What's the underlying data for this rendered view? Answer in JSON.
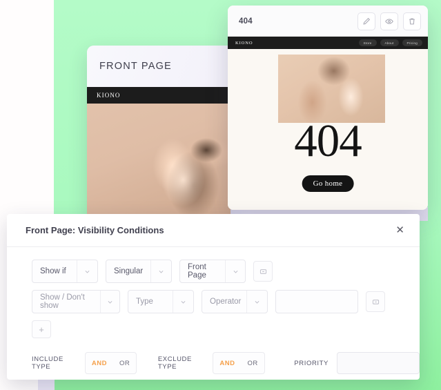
{
  "background": {
    "green": "#b3fbc7",
    "lavender": "#e6e2f4",
    "white": "#fffdfd"
  },
  "front_page_card": {
    "title": "FRONT PAGE",
    "brand": "KIONO"
  },
  "error_card": {
    "label": "404",
    "brand": "KIONO",
    "nav_items": [
      "Store",
      "About",
      "Pricing"
    ],
    "headline": "404",
    "button_label": "Go home",
    "actions": [
      {
        "name": "edit-icon",
        "title": "Edit"
      },
      {
        "name": "eye-icon",
        "title": "Preview"
      },
      {
        "name": "trash-icon",
        "title": "Delete"
      }
    ]
  },
  "modal": {
    "title": "Front Page: Visibility Conditions",
    "close_label": "✕",
    "rows": [
      {
        "selects": [
          {
            "value": "Show if",
            "placeholder": false
          },
          {
            "value": "Singular",
            "placeholder": false
          },
          {
            "value": "Front Page",
            "placeholder": false
          }
        ],
        "has_text_input": false,
        "text_input_value": "",
        "remove_label": "remove-condition"
      },
      {
        "selects": [
          {
            "value": "Show / Don't show",
            "placeholder": true
          },
          {
            "value": "Type",
            "placeholder": true
          },
          {
            "value": "Operator",
            "placeholder": true
          }
        ],
        "has_text_input": true,
        "text_input_value": "",
        "remove_label": "remove-condition"
      }
    ],
    "add_label": "+",
    "footer": {
      "include_label": "INCLUDE TYPE",
      "include_and": "AND",
      "include_or": "OR",
      "include_active": "AND",
      "exclude_label": "EXCLUDE TYPE",
      "exclude_and": "AND",
      "exclude_or": "OR",
      "exclude_active": "AND",
      "priority_label": "PRIORITY",
      "priority_value": "",
      "accent_color": "#f5a04a"
    }
  }
}
